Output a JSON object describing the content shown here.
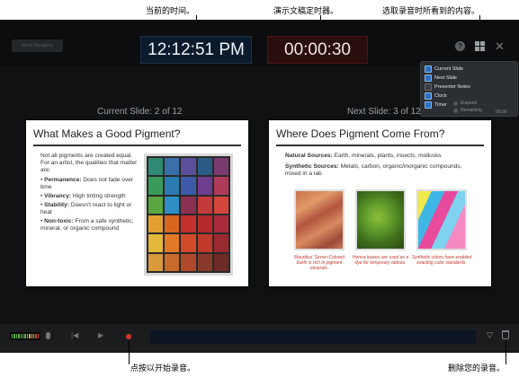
{
  "callouts": {
    "current_time": "当前的时间。",
    "rehearsal_timer": "演示文稿定时器。",
    "choose_content": "选取录音时所看到的内容。",
    "start_recording": "点按以开始录音。",
    "delete_recording": "删除您的录音。"
  },
  "toolbar": {
    "hide_navigator_label": "Show Navigator",
    "clock": "12:12:51 PM",
    "timer": "00:00:30",
    "help_icon": "question-icon",
    "layout_icon": "layout-icon",
    "close_icon": "close-icon"
  },
  "menu": {
    "items": [
      {
        "label": "Current Slide",
        "checked": true
      },
      {
        "label": "Next Slide",
        "checked": true
      },
      {
        "label": "Presenter Notes",
        "checked": false
      },
      {
        "label": "Clock",
        "checked": true
      },
      {
        "label": "Timer",
        "checked": true
      }
    ],
    "timer_options": [
      "Elapsed",
      "Remaining"
    ],
    "timer_value": "00:00"
  },
  "current_slide": {
    "label": "Current Slide: 2 of 12",
    "title": "What Makes a Good Pigment?",
    "intro": "Not all pigments are created equal. For an artist, the qualities that matter are:",
    "bullets": [
      {
        "term": "Permanence:",
        "text": "Does not fade over time"
      },
      {
        "term": "Vibrancy:",
        "text": "High tinting strength"
      },
      {
        "term": "Stability:",
        "text": "Doesn't react to light or heat"
      },
      {
        "term": "Non-toxic:",
        "text": "From a safe synthetic, mineral, or organic compound"
      }
    ]
  },
  "next_slide": {
    "label": "Next Slide: 3 of 12",
    "title": "Where Does Pigment Come From?",
    "natural_term": "Natural Sources:",
    "natural_text": "Earth, minerals, plants, insects, mollusks",
    "synthetic_term": "Synthetic Sources:",
    "synthetic_text": "Metals, carbon, organic/inorganic compounds, mixed in a lab",
    "captions": [
      "Mauritius' Seven-Colored Earth is rich in pigment minerals.",
      "Henna leaves are used as a dye for temporary tattoos.",
      "Synthetic colors have enabled exacting color standards."
    ]
  },
  "colors": {
    "app_bg": "#0f1112",
    "clock_bg": "#0c1a2d",
    "timer_bg": "#2a0d0d",
    "record_red": "#d4372c"
  }
}
